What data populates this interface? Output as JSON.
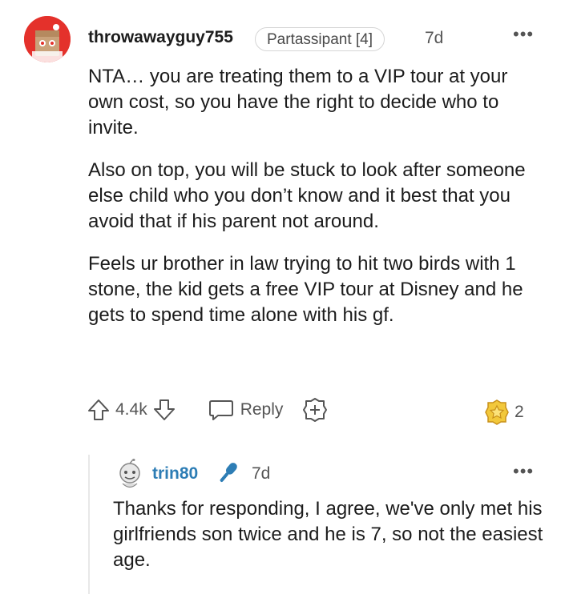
{
  "comment": {
    "username": "throwawayguy755",
    "flair": "Partassipant [4]",
    "timestamp": "7d",
    "more_label": "•••",
    "paragraphs": [
      "NTA… you are treating them to a VIP tour at your own cost, so you have the right to decide who to invite.",
      "Also on top, you will be stuck to look after someone else child who you don’t know and it best that you avoid that if his parent not around.",
      "Feels ur brother in law trying to hit two birds with 1 stone, the kid gets a free VIP tour at Disney and he gets to spend time alone with his gf."
    ],
    "vote_count": "4.4k",
    "reply_label": "Reply",
    "award_count": "2"
  },
  "reply": {
    "username": "trin80",
    "timestamp": "7d",
    "more_label": "•••",
    "text": "Thanks for responding, I agree, we've only met his girlfriends son twice and he is 7, so not the easiest age."
  },
  "icons": {
    "avatar": "snoo-avatar-icon",
    "upvote": "upvote-arrow-icon",
    "downvote": "downvote-arrow-icon",
    "reply": "speech-bubble-icon",
    "award_add": "add-award-icon",
    "award": "award-badge-icon",
    "mic": "microphone-icon"
  },
  "colors": {
    "username_reply": "#2d7db5",
    "mic": "#2d7db5",
    "avatar_bg": "#e4312b",
    "award": "#f2c83b"
  }
}
